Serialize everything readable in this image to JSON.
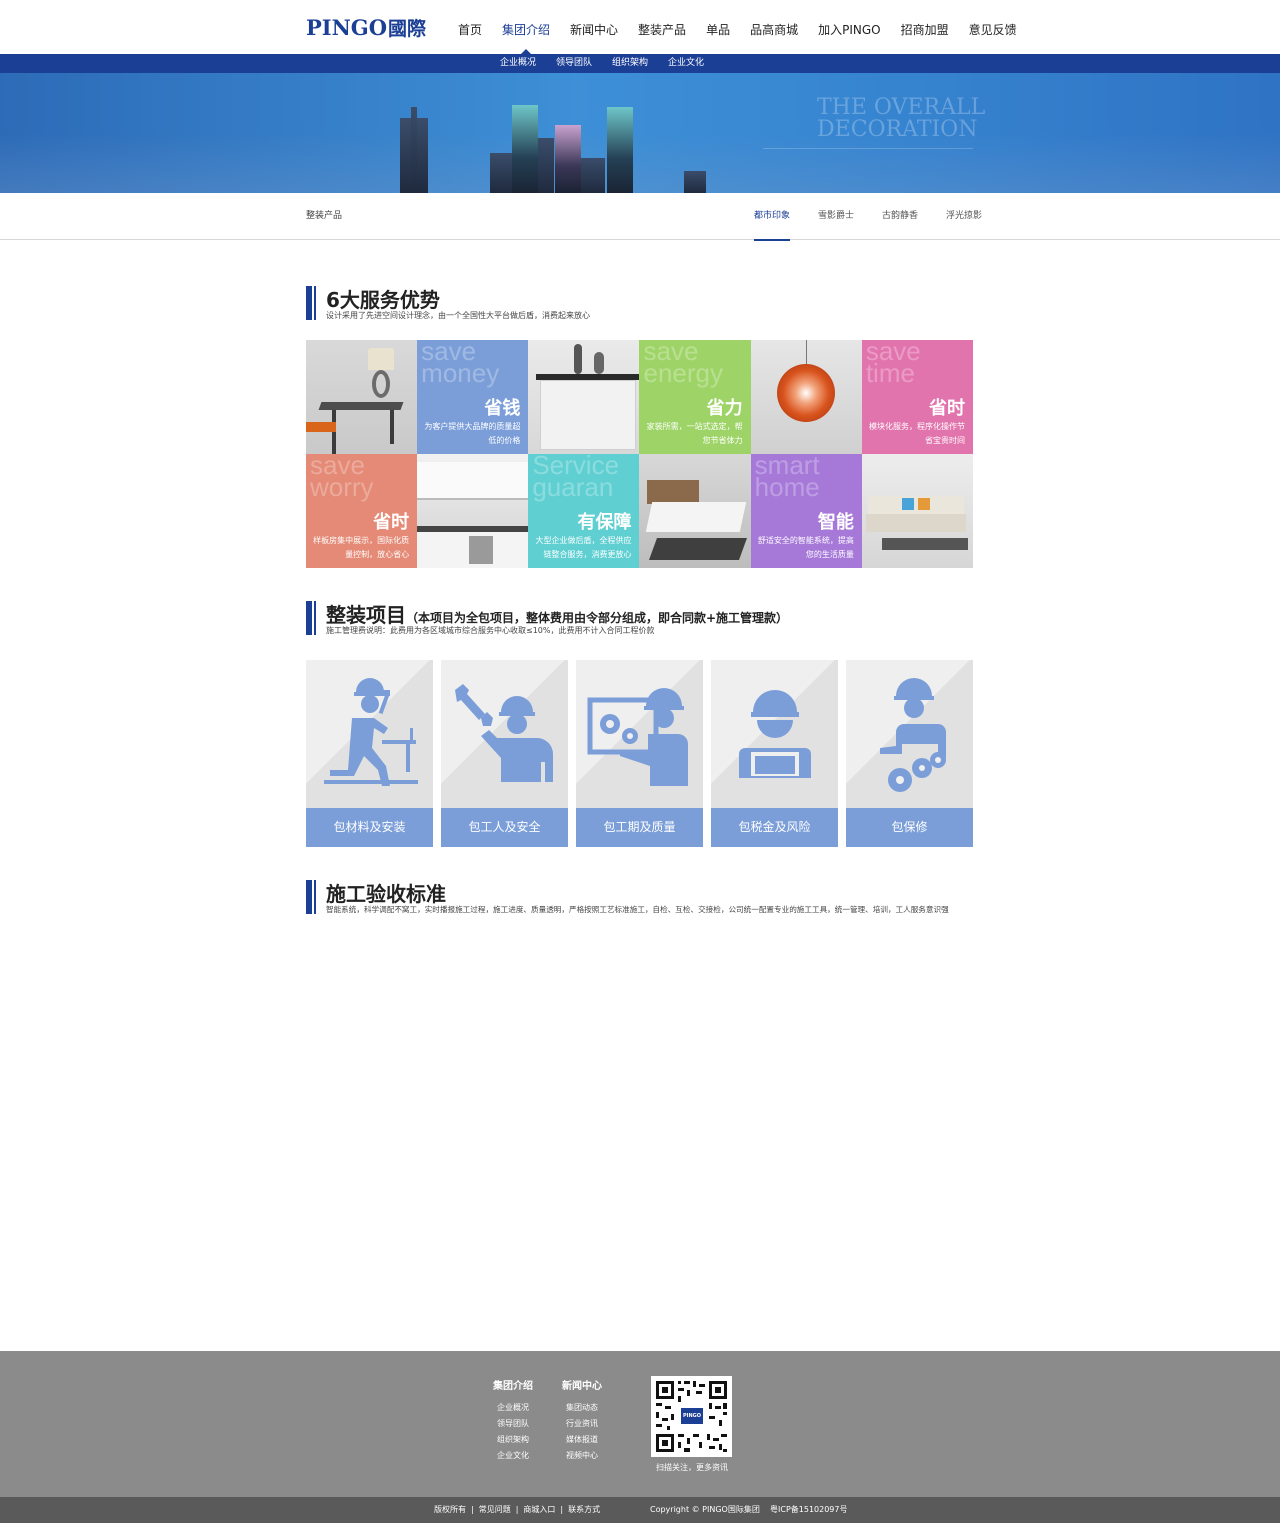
{
  "header": {
    "logo_latin": "PINGO",
    "logo_cn": "國際",
    "nav": [
      {
        "label": "首页"
      },
      {
        "label": "集团介绍",
        "active": true
      },
      {
        "label": "新闻中心"
      },
      {
        "label": "整装产品"
      },
      {
        "label": "单品"
      },
      {
        "label": "品高商城"
      },
      {
        "label": "加入PINGO"
      },
      {
        "label": "招商加盟"
      },
      {
        "label": "意见反馈"
      }
    ],
    "subnav": [
      "企业概况",
      "领导团队",
      "组织架构",
      "企业文化"
    ]
  },
  "banner": {
    "slogan_line1": "THE OVERALL",
    "slogan_line2": "DECORATION"
  },
  "tabbar": {
    "crumb": "整装产品",
    "tabs": [
      {
        "label": "都市印象",
        "active": true
      },
      {
        "label": "雪影爵士"
      },
      {
        "label": "古韵静香"
      },
      {
        "label": "浮光掠影"
      }
    ]
  },
  "advantages": {
    "title": "6大服务优势",
    "desc": "设计采用了先进空间设计理念，由一个全国性大平台做后盾，消费起来放心",
    "tiles": [
      {
        "bg_en": "save\nmoney",
        "title": "省钱",
        "desc": "为客户提供大品牌的质量超低的价格",
        "color": "#7b9ed9"
      },
      {
        "bg_en": "save\nenergy",
        "title": "省力",
        "desc": "家装所需，一站式选定，帮您节省体力",
        "color": "#9ed467"
      },
      {
        "bg_en": "save\ntime",
        "title": "省时",
        "desc": "模块化服务，程序化操作节省宝贵时间",
        "color": "#e274ad"
      },
      {
        "bg_en": "save\nworry",
        "title": "省时",
        "desc": "样板房集中展示，国际化质量控制，放心省心",
        "color": "#e48a76"
      },
      {
        "bg_en": "Service\nguaran",
        "title": "有保障",
        "desc": "大型企业做后盾，全程供应链整合服务，消费更放心",
        "color": "#5fcfd2"
      },
      {
        "bg_en": "smart\nhome",
        "title": "智能",
        "desc": "舒适安全的智能系统，提高您的生活质量",
        "color": "#a679d9"
      }
    ]
  },
  "projects": {
    "title": "整装项目",
    "note": "（本项目为全包项目，整体费用由令部分组成，即合同款+施工管理款）",
    "desc": "施工管理费说明：此费用为各区域城市综合服务中心收取≤10%，此费用不计入合同工程价款",
    "items": [
      {
        "label": "包材料及安装",
        "icon": "worker-hammer-icon"
      },
      {
        "label": "包工人及安全",
        "icon": "worker-wrench-icon"
      },
      {
        "label": "包工期及质量",
        "icon": "worker-gears-board-icon"
      },
      {
        "label": "包税金及风险",
        "icon": "worker-laptop-icon"
      },
      {
        "label": "包保修",
        "icon": "worker-gears-icon"
      }
    ]
  },
  "acceptance": {
    "title": "施工验收标准",
    "desc": "智能系统，科学调配不窝工，实时播报施工过程，施工进度、质量透明，严格按照工艺标准施工，自检、互检、交接检，公司统一配置专业的施工工具，统一管理、培训，工人服务意识强"
  },
  "footer": {
    "col1": {
      "title": "集团介绍",
      "items": [
        "企业概况",
        "领导团队",
        "组织架构",
        "企业文化"
      ]
    },
    "col2": {
      "title": "新闻中心",
      "items": [
        "集团动态",
        "行业资讯",
        "媒体报道",
        "视频中心"
      ]
    },
    "qr_logo": "PINGO",
    "qr_caption": "扫描关注，更多资讯",
    "links": [
      "版权所有",
      "常见问题",
      "商城入口",
      "联系方式"
    ],
    "copyright": "Copyright © PINGO国际集团",
    "icp": "粤ICP备15102097号"
  },
  "colors": {
    "brand": "#1c3f96",
    "project_label": "#7b9ed9",
    "footer": "#8b8b8b",
    "bottom_bar": "#5a5a5a"
  }
}
